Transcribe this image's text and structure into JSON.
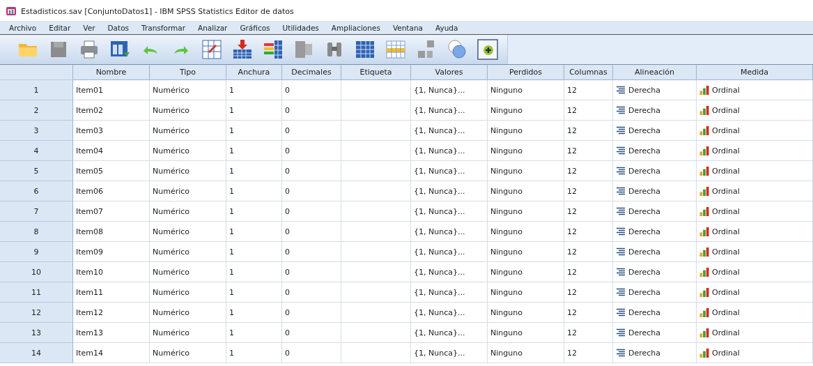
{
  "window": {
    "title": "Estadisticos.sav [ConjuntoDatos1] - IBM SPSS Statistics Editor de datos"
  },
  "menu": [
    "Archivo",
    "Editar",
    "Ver",
    "Datos",
    "Transformar",
    "Analizar",
    "Gráficos",
    "Utilidades",
    "Ampliaciones",
    "Ventana",
    "Ayuda"
  ],
  "table": {
    "columns": [
      {
        "label": "Nombre",
        "kind": "text"
      },
      {
        "label": "Tipo",
        "kind": "text"
      },
      {
        "label": "Anchura",
        "kind": "text"
      },
      {
        "label": "Decimales",
        "kind": "text"
      },
      {
        "label": "Etiqueta",
        "kind": "text"
      },
      {
        "label": "Valores",
        "kind": "text"
      },
      {
        "label": "Perdidos",
        "kind": "text"
      },
      {
        "label": "Columnas",
        "kind": "text"
      },
      {
        "label": "Alineación",
        "kind": "align"
      },
      {
        "label": "Medida",
        "kind": "measure"
      }
    ],
    "rows": [
      {
        "number": "1",
        "cells": [
          "Item01",
          "Numérico",
          "1",
          "0",
          "",
          "{1, Nunca}...",
          "Ninguno",
          "12",
          "Derecha",
          "Ordinal"
        ]
      },
      {
        "number": "2",
        "cells": [
          "Item02",
          "Numérico",
          "1",
          "0",
          "",
          "{1, Nunca}...",
          "Ninguno",
          "12",
          "Derecha",
          "Ordinal"
        ]
      },
      {
        "number": "3",
        "cells": [
          "Item03",
          "Numérico",
          "1",
          "0",
          "",
          "{1, Nunca}...",
          "Ninguno",
          "12",
          "Derecha",
          "Ordinal"
        ]
      },
      {
        "number": "4",
        "cells": [
          "Item04",
          "Numérico",
          "1",
          "0",
          "",
          "{1, Nunca}...",
          "Ninguno",
          "12",
          "Derecha",
          "Ordinal"
        ]
      },
      {
        "number": "5",
        "cells": [
          "Item05",
          "Numérico",
          "1",
          "0",
          "",
          "{1, Nunca}...",
          "Ninguno",
          "12",
          "Derecha",
          "Ordinal"
        ]
      },
      {
        "number": "6",
        "cells": [
          "Item06",
          "Numérico",
          "1",
          "0",
          "",
          "{1, Nunca}...",
          "Ninguno",
          "12",
          "Derecha",
          "Ordinal"
        ]
      },
      {
        "number": "7",
        "cells": [
          "Item07",
          "Numérico",
          "1",
          "0",
          "",
          "{1, Nunca}...",
          "Ninguno",
          "12",
          "Derecha",
          "Ordinal"
        ]
      },
      {
        "number": "8",
        "cells": [
          "Item08",
          "Numérico",
          "1",
          "0",
          "",
          "{1, Nunca}...",
          "Ninguno",
          "12",
          "Derecha",
          "Ordinal"
        ]
      },
      {
        "number": "9",
        "cells": [
          "Item09",
          "Numérico",
          "1",
          "0",
          "",
          "{1, Nunca}...",
          "Ninguno",
          "12",
          "Derecha",
          "Ordinal"
        ]
      },
      {
        "number": "10",
        "cells": [
          "Item10",
          "Numérico",
          "1",
          "0",
          "",
          "{1, Nunca}...",
          "Ninguno",
          "12",
          "Derecha",
          "Ordinal"
        ]
      },
      {
        "number": "11",
        "cells": [
          "Item11",
          "Numérico",
          "1",
          "0",
          "",
          "{1, Nunca}...",
          "Ninguno",
          "12",
          "Derecha",
          "Ordinal"
        ]
      },
      {
        "number": "12",
        "cells": [
          "Item12",
          "Numérico",
          "1",
          "0",
          "",
          "{1, Nunca}...",
          "Ninguno",
          "12",
          "Derecha",
          "Ordinal"
        ]
      },
      {
        "number": "13",
        "cells": [
          "Item13",
          "Numérico",
          "1",
          "0",
          "",
          "{1, Nunca}...",
          "Ninguno",
          "12",
          "Derecha",
          "Ordinal"
        ]
      },
      {
        "number": "14",
        "cells": [
          "Item14",
          "Numérico",
          "1",
          "0",
          "",
          "{1, Nunca}...",
          "Ninguno",
          "12",
          "Derecha",
          "Ordinal"
        ]
      }
    ]
  }
}
